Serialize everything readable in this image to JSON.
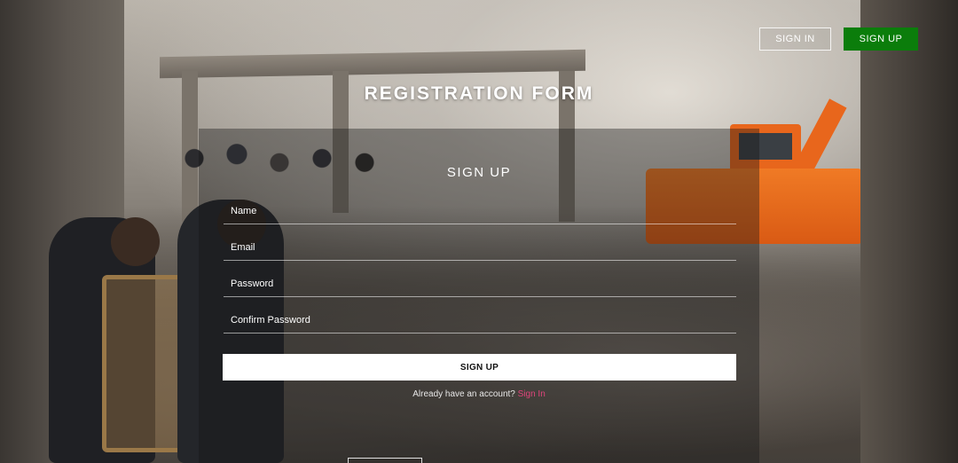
{
  "nav": {
    "signin_label": "SIGN IN",
    "signup_label": "SIGN UP"
  },
  "form": {
    "title": "REGISTRATION FORM",
    "heading": "SIGN UP",
    "fields": {
      "name_placeholder": "Name",
      "email_placeholder": "Email",
      "password_placeholder": "Password",
      "confirm_placeholder": "Confirm Password"
    },
    "submit_label": "SIGN UP",
    "account_prompt": "Already have an account?",
    "signin_link": "Sign In"
  },
  "colors": {
    "signup_green": "#0b7d0b",
    "link_pink": "#e0457b"
  }
}
